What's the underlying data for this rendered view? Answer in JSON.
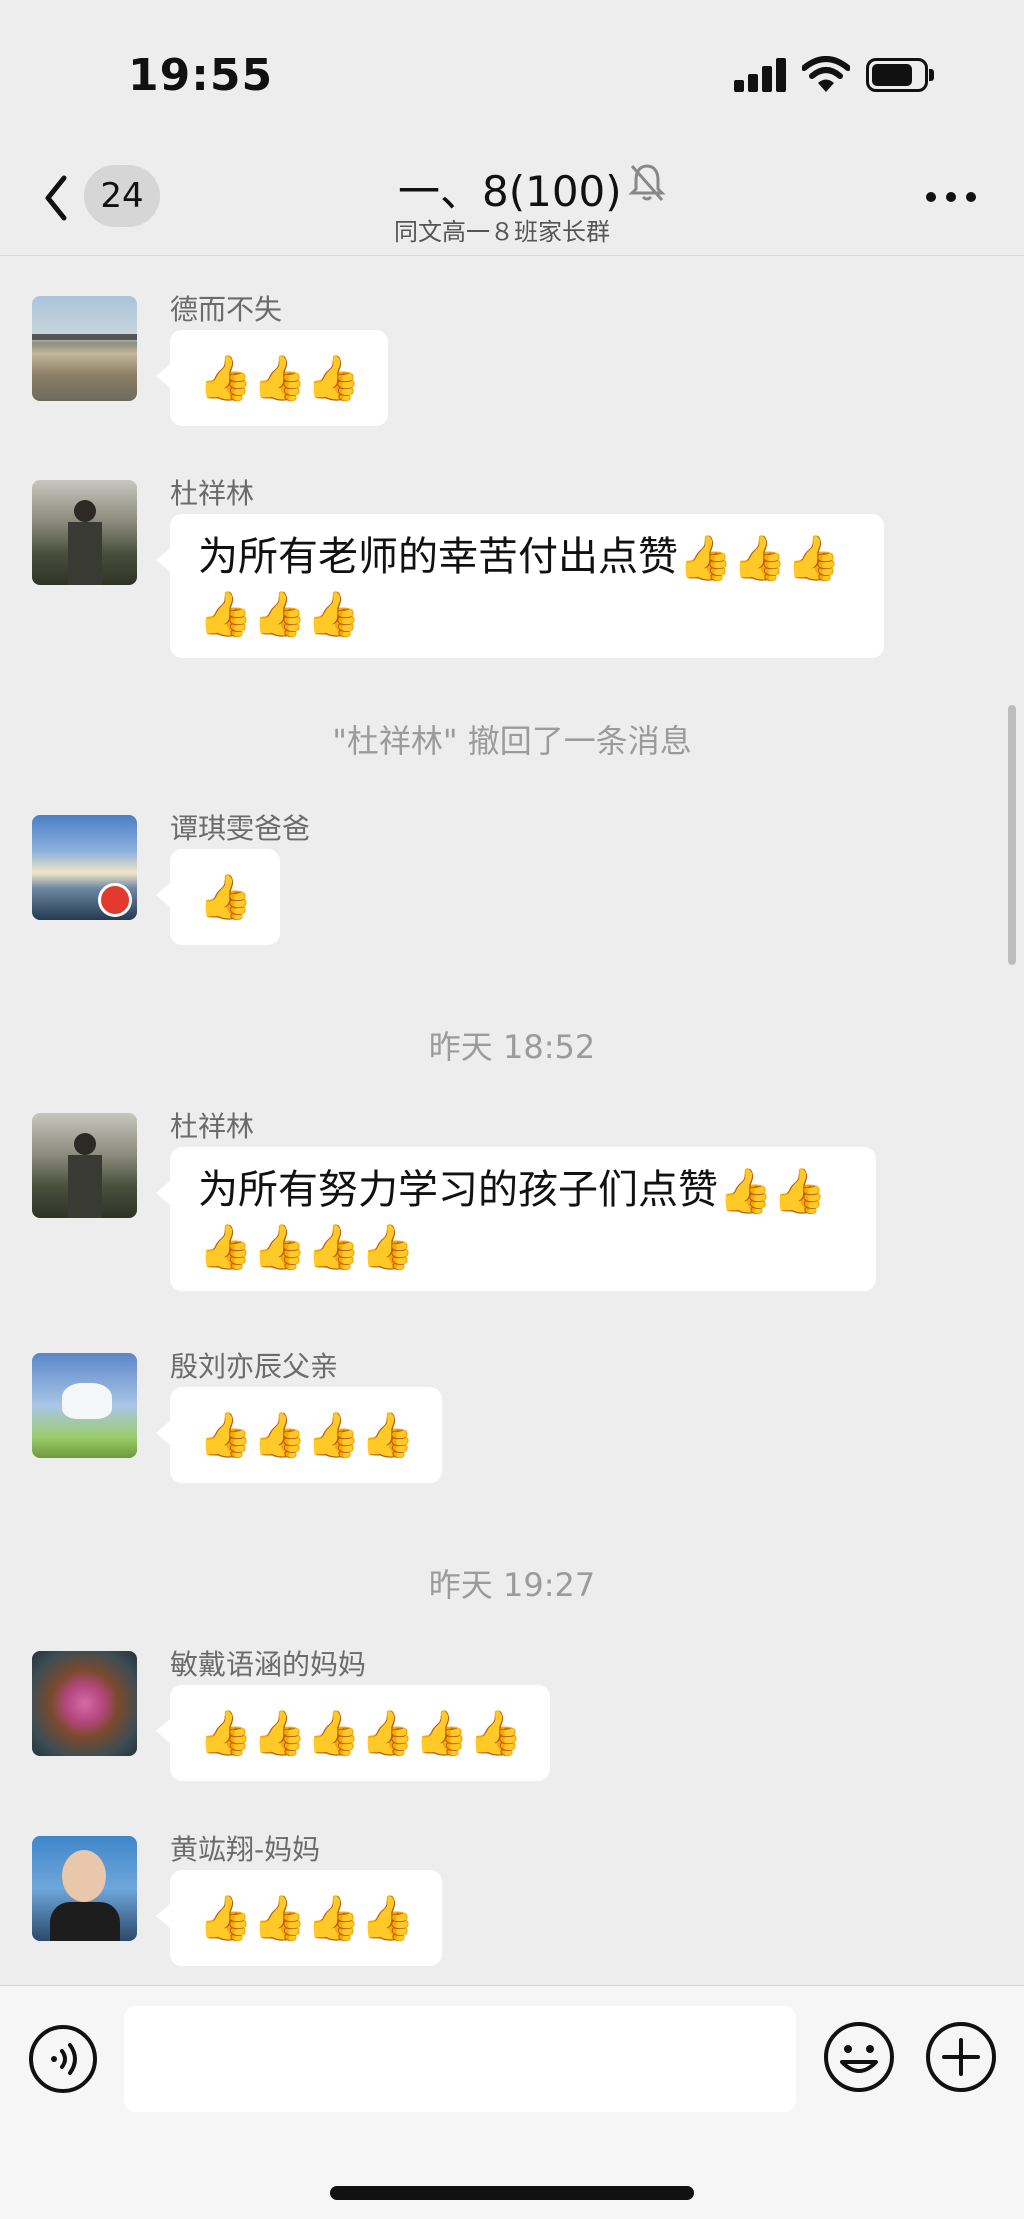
{
  "status_bar": {
    "time": "19:55"
  },
  "header": {
    "unread_count": "24",
    "title": "一、8(100)",
    "subtitle": "同文高一８班家长群"
  },
  "messages": [
    {
      "sender": "德而不失",
      "text": "",
      "thumbs": 3,
      "avatar": "bridge-river-photo"
    },
    {
      "sender": "杜祥林",
      "text": "为所有老师的幸苦付出点赞",
      "thumbs": 6,
      "avatar": "man-standing-photo"
    },
    {
      "sender": "谭琪雯爸爸",
      "text": "",
      "thumbs": 1,
      "avatar": "sunset-sky-photo"
    },
    {
      "sender": "杜祥林",
      "text": "为所有努力学习的孩子们点赞",
      "thumbs": 6,
      "avatar": "man-standing-photo"
    },
    {
      "sender": "殷刘亦辰父亲",
      "text": "",
      "thumbs": 4,
      "avatar": "white-horse-photo"
    },
    {
      "sender": "敏戴语涵的妈妈",
      "text": "",
      "thumbs": 6,
      "avatar": "paper-flowers-photo"
    },
    {
      "sender": "黄竑翔-妈妈",
      "text": "",
      "thumbs": 4,
      "avatar": "woman-portrait-photo"
    }
  ],
  "system_notice": "\"杜祥林\" 撤回了一条消息",
  "time_separators": [
    "昨天 18:52",
    "昨天 19:27"
  ],
  "input": {
    "placeholder": ""
  },
  "colors": {
    "background": "#ededed",
    "bubble": "#ffffff",
    "thumb": "#f2b021"
  }
}
